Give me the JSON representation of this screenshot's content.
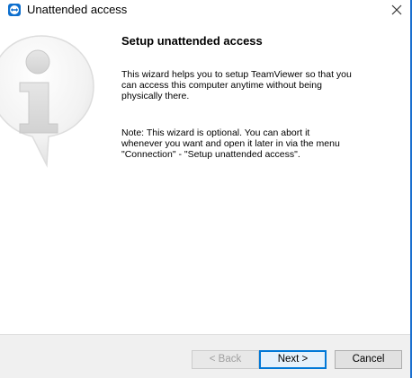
{
  "window": {
    "title": "Unattended access",
    "icon": "teamviewer-icon",
    "close_icon": "close-icon",
    "accent_color": "#1a6fcf"
  },
  "content": {
    "watermark_icon": "info-speech-bubble-icon",
    "heading": "Setup unattended access",
    "paragraph1": "This wizard helps you to setup TeamViewer so that you\ncan access this computer anytime without being\nphysically there.",
    "paragraph2": "Note: This wizard is optional. You can abort it\nwhenever you want and open it later in via the menu\n\"Connection\" - \"Setup unattended access\"."
  },
  "buttons": {
    "back": "< Back",
    "next": "Next >",
    "cancel": "Cancel"
  }
}
